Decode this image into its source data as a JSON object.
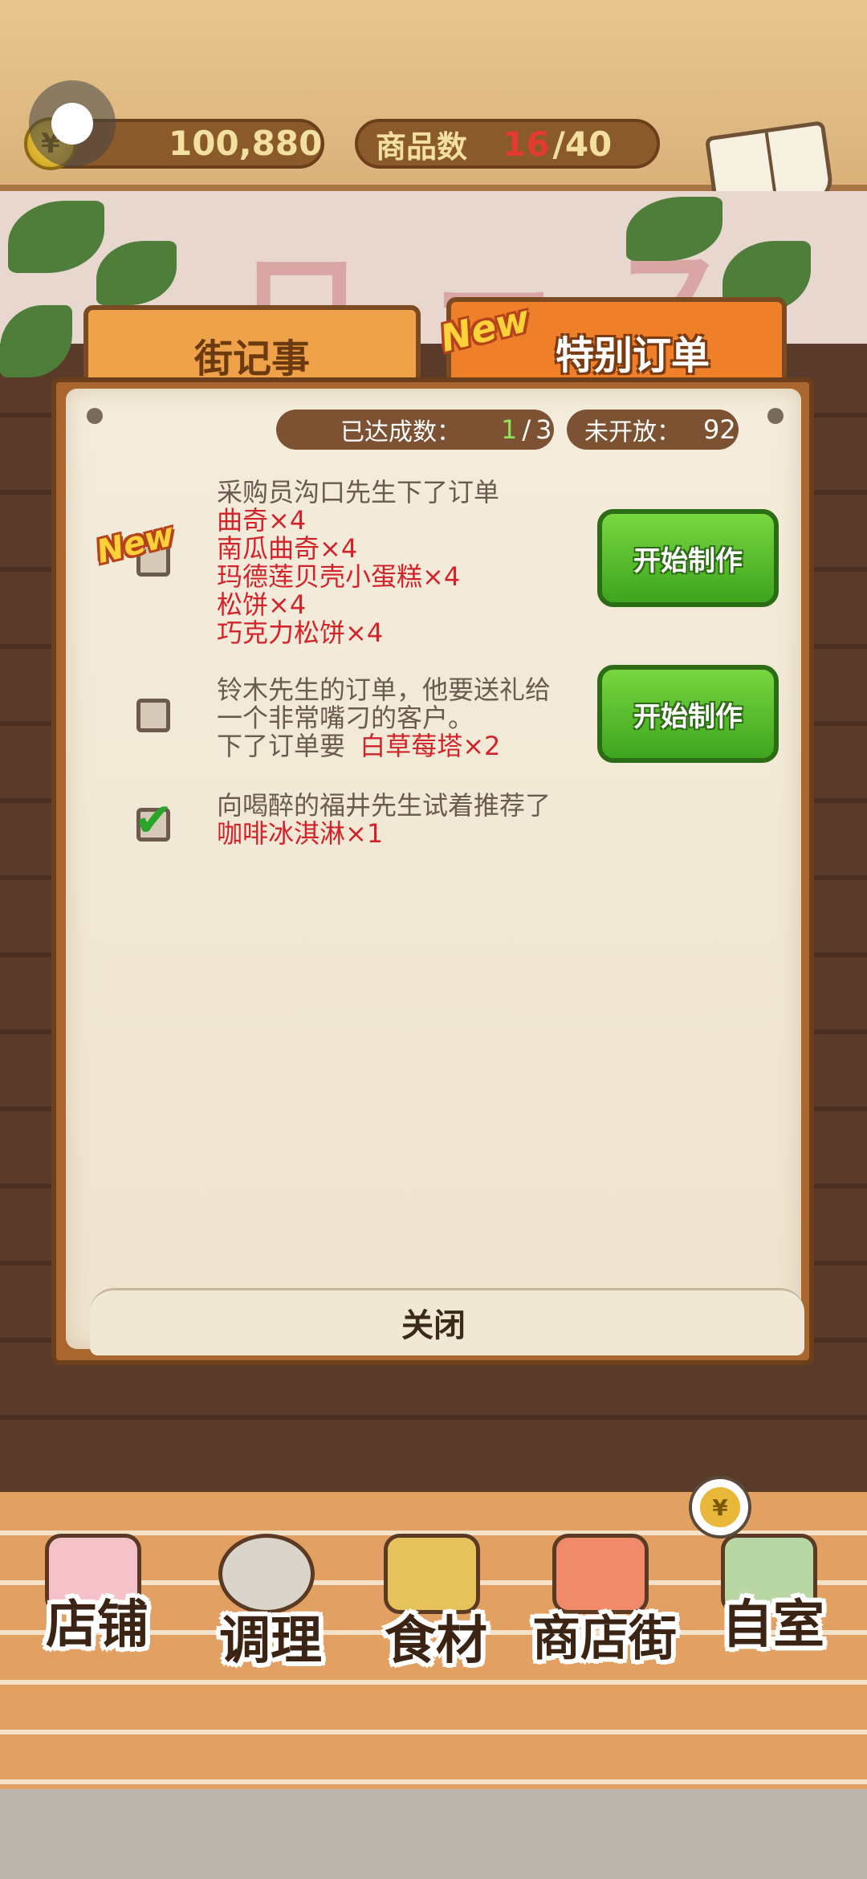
{
  "header": {
    "coin_symbol": "¥",
    "coins": "100,880",
    "goods_label": "商品数",
    "goods_current": "16",
    "goods_separator": "/",
    "goods_max": "40",
    "recipe_label": "食谱"
  },
  "tabs": {
    "street_news": "街记事",
    "special_orders": "特别订单",
    "new_badge": "New"
  },
  "stats": {
    "achieved_label": "已达成数：",
    "achieved_current": "1",
    "achieved_separator": "/",
    "achieved_total": "3",
    "locked_label": "未开放：",
    "locked_count": "92"
  },
  "orders": [
    {
      "new_badge": "New",
      "intro": "采购员沟口先生下了订单",
      "items": [
        "曲奇×4",
        "南瓜曲奇×4",
        "玛德莲贝壳小蛋糕×4",
        "松饼×4",
        "巧克力松饼×4"
      ],
      "checked": false,
      "button": "开始制作"
    },
    {
      "intro_line1": "铃木先生的订单，他要送礼给",
      "intro_line2": "一个非常嘴刁的客户。",
      "intro_line3": "下了订单要",
      "item": "白草莓塔×2",
      "checked": false,
      "button": "开始制作"
    },
    {
      "intro": "向喝醉的福井先生试着推荐了",
      "item": "咖啡冰淇淋×1",
      "checked": true,
      "check_symbol": "✔"
    }
  ],
  "close_label": "关闭",
  "nav": {
    "shop": "店铺",
    "cooking": "调理",
    "ingredients": "食材",
    "shopping_street": "商店街",
    "own_room": "自室",
    "yen_symbol": "¥"
  },
  "colors": {
    "accent_orange": "#f07f2a",
    "button_green": "#3ea51f",
    "item_red": "#d2232a",
    "text_brown": "#3b2414"
  }
}
